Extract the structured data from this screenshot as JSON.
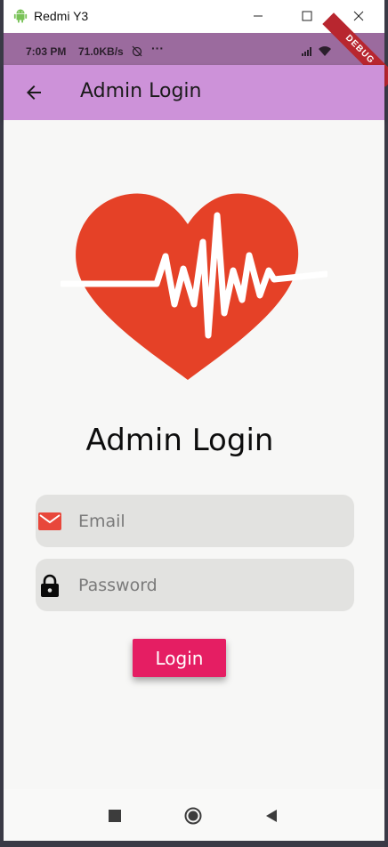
{
  "window": {
    "title": "Redmi Y3"
  },
  "status_bar": {
    "time": "7:03 PM",
    "speed": "71.0KB/s",
    "more": "···",
    "debug_banner": "DEBUG"
  },
  "app_bar": {
    "title": "Admin Login"
  },
  "main": {
    "heading": "Admin Login",
    "email": {
      "placeholder": "Email",
      "value": ""
    },
    "password": {
      "placeholder": "Password",
      "value": ""
    },
    "login_label": "Login"
  },
  "colors": {
    "app_bar": "#cd92d9",
    "status_bar": "#9b6b9e",
    "heart": "#e54127",
    "login_button": "#e51e63",
    "email_icon": "#e8473b"
  },
  "icons": {
    "titlebar": "android-icon",
    "back": "arrow-back-icon",
    "email": "mail-icon",
    "password": "lock-icon",
    "nav": [
      "square-icon",
      "circle-icon",
      "triangle-back-icon"
    ]
  }
}
